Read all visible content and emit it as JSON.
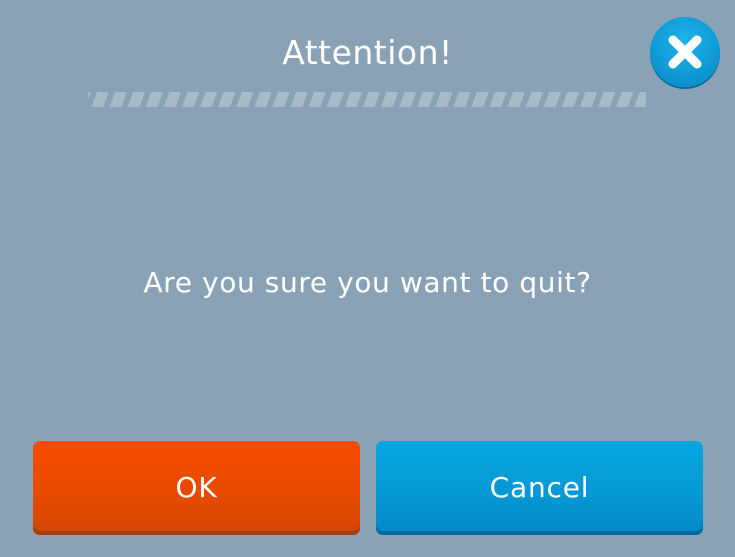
{
  "dialog": {
    "title": "Attention!",
    "message": "Are you sure you want to quit?",
    "ok_label": "OK",
    "cancel_label": "Cancel",
    "close_icon": "close-icon"
  },
  "colors": {
    "background": "#8aa2b6",
    "ok_button": "#f04b00",
    "cancel_button": "#0599d6",
    "close_button": "#13a6e0",
    "text": "#ffffff"
  }
}
